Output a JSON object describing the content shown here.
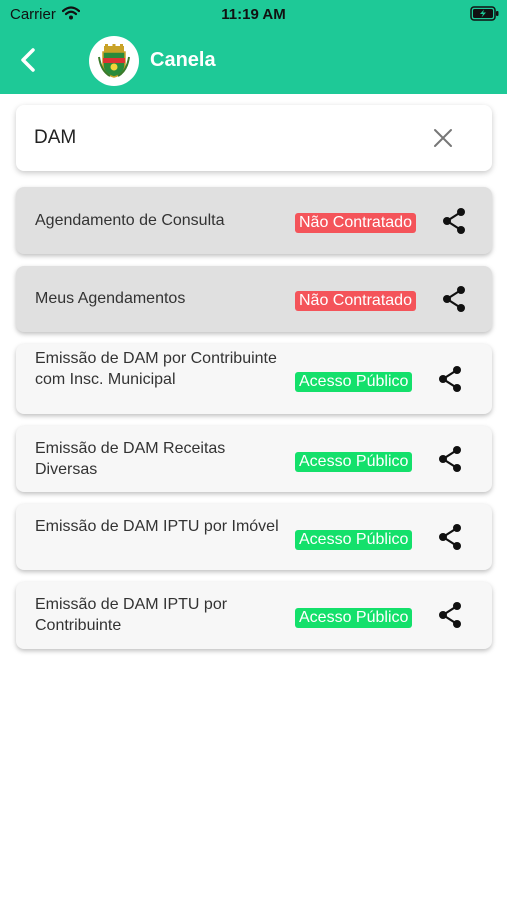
{
  "status_bar": {
    "carrier": "Carrier",
    "time": "11:19 AM"
  },
  "header": {
    "title": "Canela",
    "back_icon": "chevron-left-icon",
    "logo": "city-coat-of-arms"
  },
  "search": {
    "value": "DAM",
    "clear_icon": "close-icon"
  },
  "colors": {
    "primary": "#1ec997",
    "badge_not_contracted": "#f4545a",
    "badge_public": "#14e06b"
  },
  "services": [
    {
      "name": "Agendamento de Consulta",
      "status": "Não Contratado",
      "kind": "not-contracted"
    },
    {
      "name": "Meus Agendamentos",
      "status": "Não Contratado",
      "kind": "not-contracted"
    },
    {
      "name": "Emissão de DAM por Contribuinte com Insc. Municipal",
      "status": "Acesso Público",
      "kind": "public"
    },
    {
      "name": "Emissão de DAM Receitas Diversas",
      "status": "Acesso Público",
      "kind": "public"
    },
    {
      "name": "Emissão de DAM IPTU por Imóvel",
      "status": "Acesso Público",
      "kind": "public"
    },
    {
      "name": "Emissão de DAM IPTU por Contribuinte",
      "status": "Acesso Público",
      "kind": "public"
    }
  ]
}
